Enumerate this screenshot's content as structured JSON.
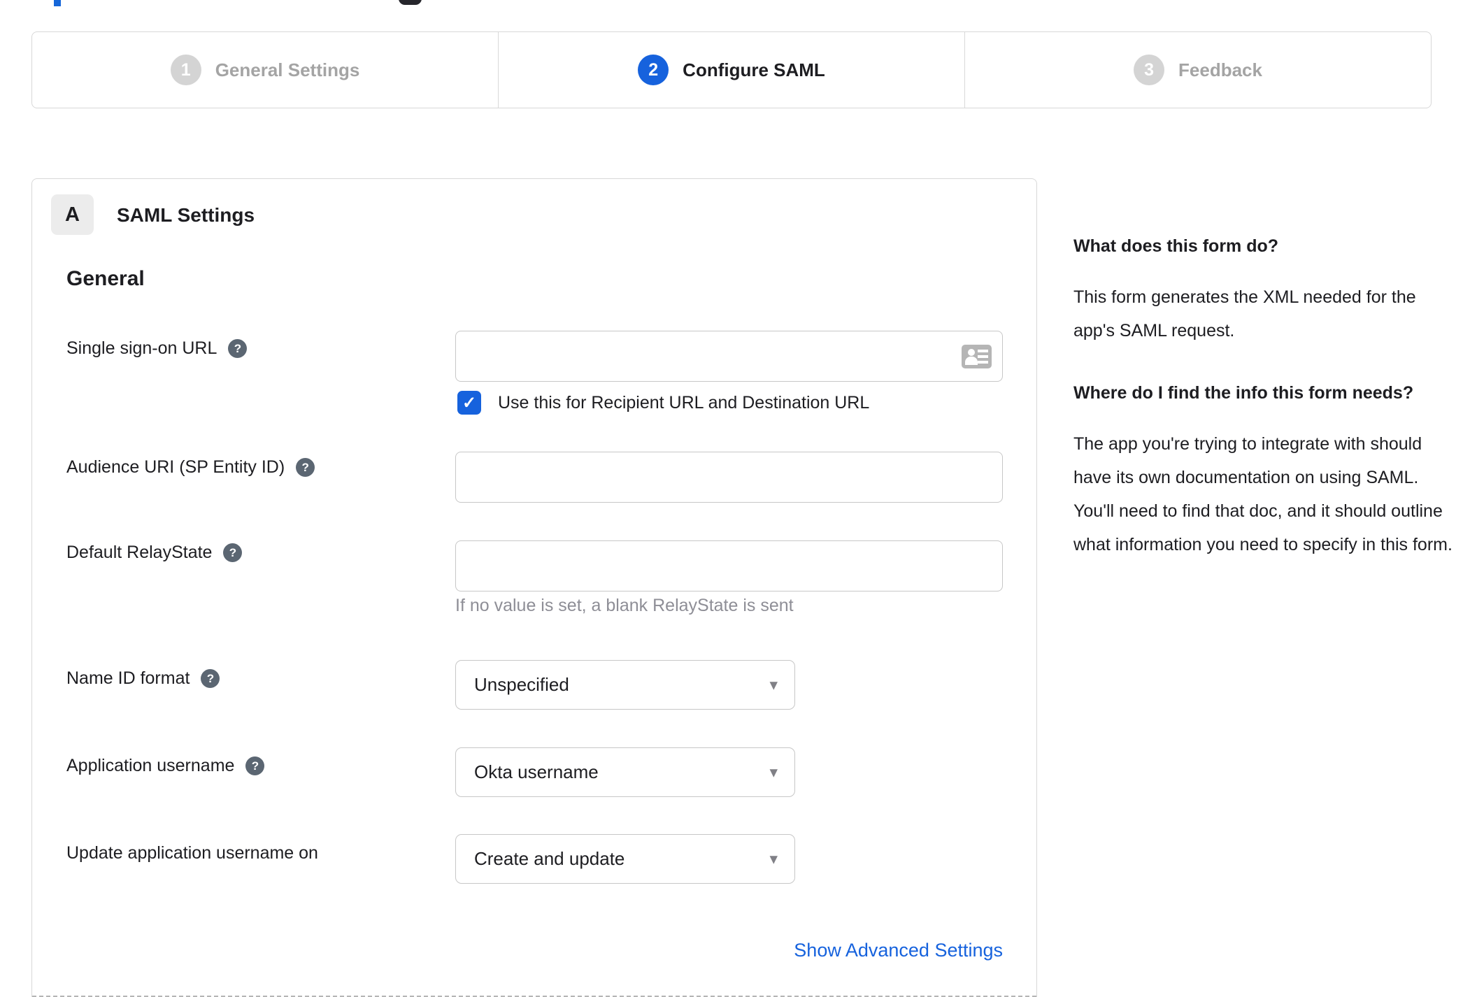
{
  "stepper": {
    "steps": [
      {
        "number": "1",
        "label": "General Settings",
        "state": "inactive"
      },
      {
        "number": "2",
        "label": "Configure SAML",
        "state": "active"
      },
      {
        "number": "3",
        "label": "Feedback",
        "state": "inactive"
      }
    ]
  },
  "panel": {
    "section_badge": "A",
    "section_title": "SAML Settings",
    "group_title": "General",
    "fields": {
      "sso_url": {
        "label": "Single sign-on URL",
        "value": ""
      },
      "sso_checkbox": {
        "label": "Use this for Recipient URL and Destination URL",
        "checked": true
      },
      "audience_uri": {
        "label": "Audience URI (SP Entity ID)",
        "value": ""
      },
      "relay_state": {
        "label": "Default RelayState",
        "value": "",
        "hint": "If no value is set, a blank RelayState is sent"
      },
      "name_id_format": {
        "label": "Name ID format",
        "value": "Unspecified"
      },
      "app_username": {
        "label": "Application username",
        "value": "Okta username"
      },
      "update_app_username": {
        "label": "Update application username on",
        "value": "Create and update"
      }
    },
    "advanced_link": "Show Advanced Settings"
  },
  "sidebar": {
    "q1_title": "What does this form do?",
    "q1_body": "This form generates the XML needed for the app's SAML request.",
    "q2_title": "Where do I find the info this form needs?",
    "q2_body": "The app you're trying to integrate with should have its own documentation on using SAML. You'll need to find that doc, and it should outline what information you need to specify in this form."
  },
  "icons": {
    "help": "?",
    "check": "✓",
    "caret": "▾"
  },
  "colors": {
    "accent_blue": "#1662dd",
    "text": "#1d1d21",
    "inactive_gray": "#a4a4a4",
    "border_gray": "#d8d8d8",
    "hint_gray": "#8e8e96"
  }
}
